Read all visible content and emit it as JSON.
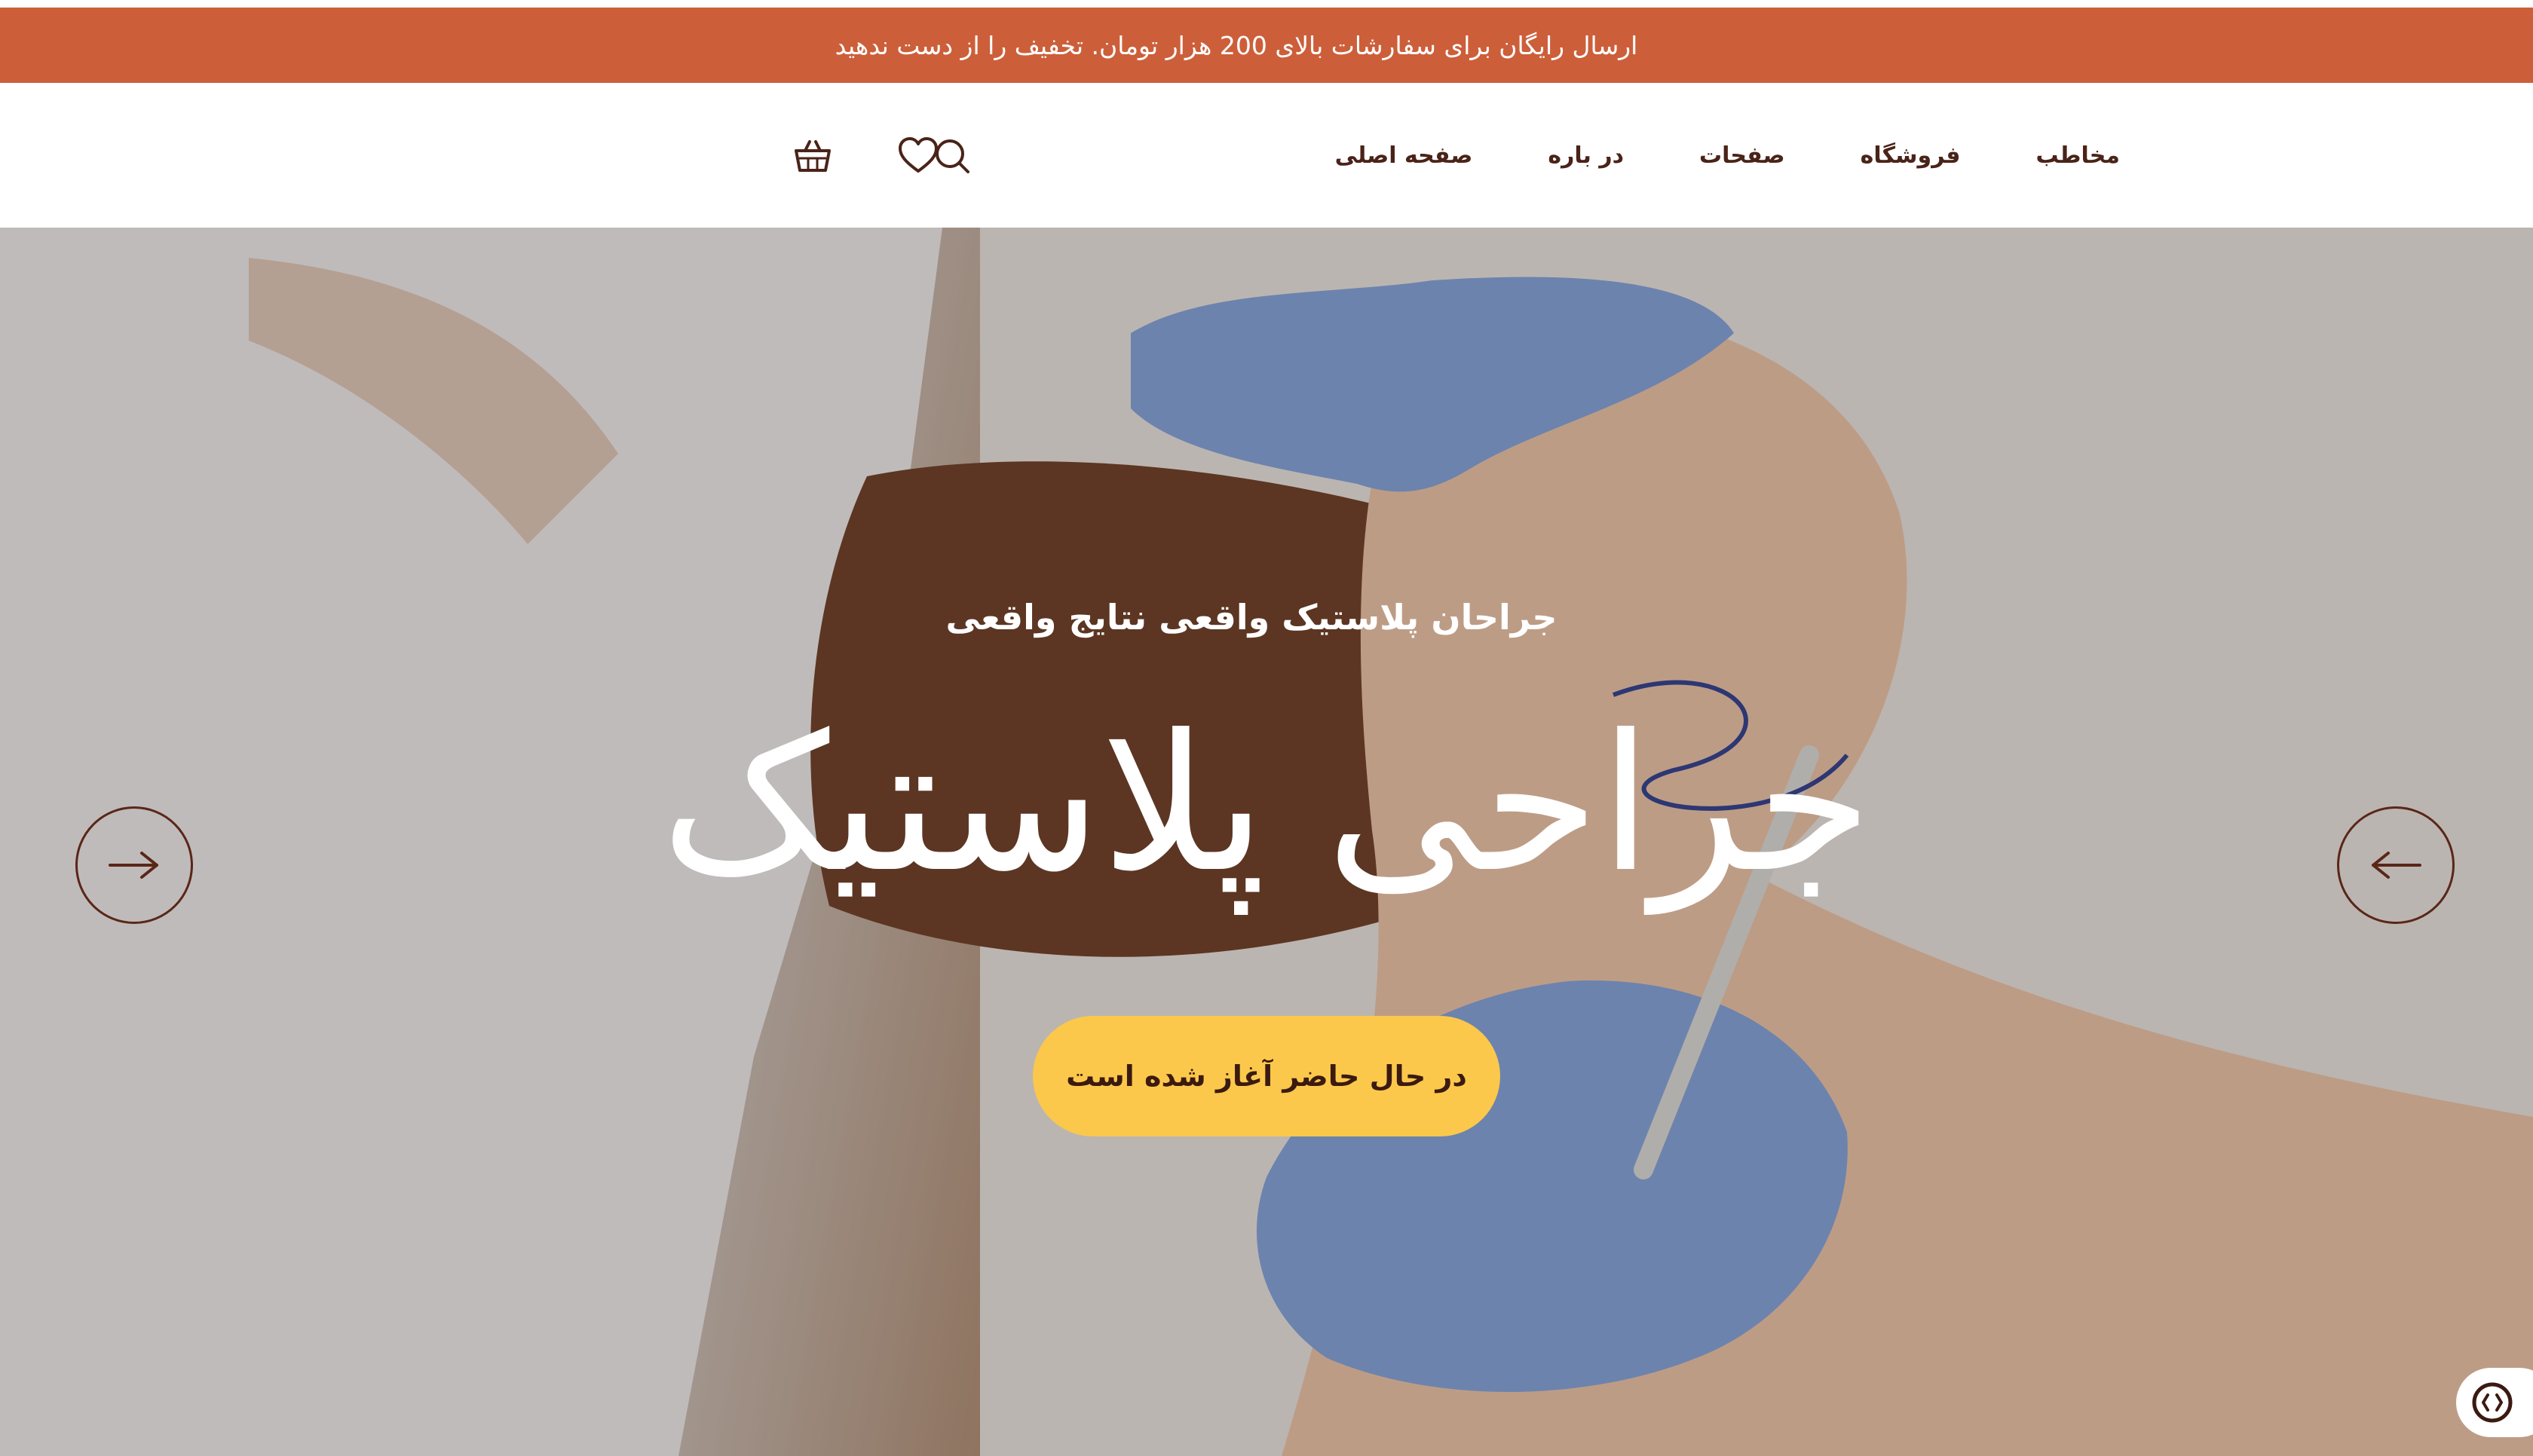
{
  "announcement": {
    "text": "ارسال رایگان برای سفارشات بالای 200 هزار تومان. تخفیف را از دست ندهید"
  },
  "nav": {
    "items": [
      {
        "label": "صفحه اصلی"
      },
      {
        "label": "در باره"
      },
      {
        "label": "صفحات"
      },
      {
        "label": "فروشگاه"
      },
      {
        "label": "مخاطب"
      }
    ]
  },
  "header_icons": [
    "search-icon",
    "heart-icon",
    "basket-icon"
  ],
  "hero": {
    "subtitle": "جراحان پلاستیک واقعی نتایج واقعی",
    "title": "جراحی پلاستیک",
    "cta_label": "در حال حاضر آغاز شده است",
    "prev_icon": "arrow-right-icon",
    "next_icon": "arrow-left-icon"
  },
  "colors": {
    "announcement_bg": "#cc5f3a",
    "nav_text": "#4a2318",
    "cta_bg": "#fbc84b",
    "cta_text": "#3b1a10",
    "arrow_stroke": "#5a2618"
  },
  "fab_icon": "accessibility-icon"
}
